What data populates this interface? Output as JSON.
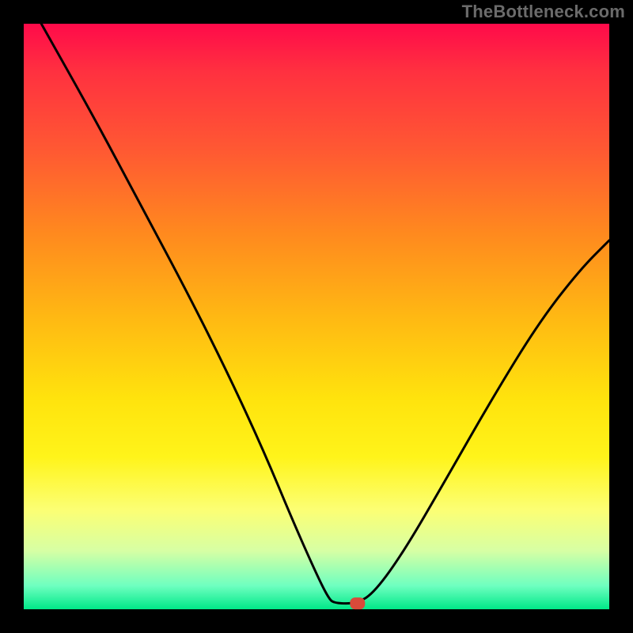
{
  "watermark": "TheBottleneck.com",
  "chart_data": {
    "type": "line",
    "title": "",
    "xlabel": "",
    "ylabel": "",
    "xlim": [
      0,
      100
    ],
    "ylim": [
      0,
      100
    ],
    "grid": false,
    "legend": false,
    "background_gradient": {
      "top_color": "#ff0a4a",
      "mid_color": "#ffe30d",
      "bottom_color": "#00e888",
      "meaning": "high (red) → low (green) bottleneck severity"
    },
    "series": [
      {
        "name": "bottleneck-curve",
        "color": "#000000",
        "points": [
          {
            "x": 3,
            "y": 100
          },
          {
            "x": 12,
            "y": 84
          },
          {
            "x": 20,
            "y": 69
          },
          {
            "x": 28,
            "y": 54
          },
          {
            "x": 35,
            "y": 40
          },
          {
            "x": 41,
            "y": 27
          },
          {
            "x": 46,
            "y": 15
          },
          {
            "x": 50,
            "y": 6
          },
          {
            "x": 52,
            "y": 2
          },
          {
            "x": 53,
            "y": 1
          },
          {
            "x": 57,
            "y": 1
          },
          {
            "x": 60,
            "y": 3
          },
          {
            "x": 65,
            "y": 10
          },
          {
            "x": 72,
            "y": 22
          },
          {
            "x": 80,
            "y": 36
          },
          {
            "x": 88,
            "y": 49
          },
          {
            "x": 95,
            "y": 58
          },
          {
            "x": 100,
            "y": 63
          }
        ]
      }
    ],
    "marker": {
      "name": "optimal-point",
      "x": 57,
      "y": 1,
      "shape": "rounded-rect",
      "color": "#d94a3a"
    }
  }
}
